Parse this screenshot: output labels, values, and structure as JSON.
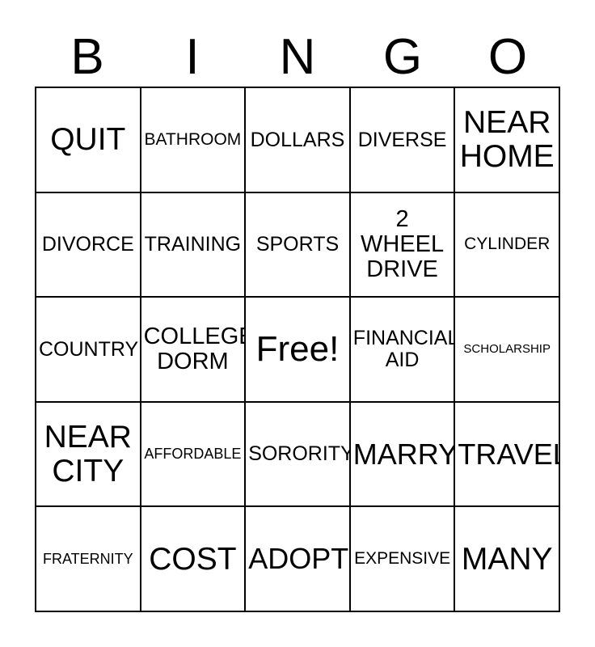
{
  "header": {
    "letters": [
      "B",
      "I",
      "N",
      "G",
      "O"
    ]
  },
  "grid": {
    "rows": 5,
    "columns": 5,
    "border_color": "#000000",
    "background_color": "#ffffff",
    "text_color": "#000000",
    "cells": [
      {
        "text": "QUIT",
        "size": "fs-xxl"
      },
      {
        "text": "BATHROOM",
        "size": "fs-s"
      },
      {
        "text": "DOLLARS",
        "size": "fs-m"
      },
      {
        "text": "DIVERSE",
        "size": "fs-m"
      },
      {
        "text": "NEAR\nHOME",
        "size": "fs-xxl"
      },
      {
        "text": "DIVORCE",
        "size": "fs-m"
      },
      {
        "text": "TRAINING",
        "size": "fs-m"
      },
      {
        "text": "SPORTS",
        "size": "fs-m"
      },
      {
        "text": "2\nWHEEL\nDRIVE",
        "size": "fs-l"
      },
      {
        "text": "CYLINDER",
        "size": "fs-s"
      },
      {
        "text": "COUNTRY",
        "size": "fs-m"
      },
      {
        "text": "COLLEGE\nDORM",
        "size": "fs-l"
      },
      {
        "text": "Free!",
        "size": "fs-free"
      },
      {
        "text": "FINANCIAL\nAID",
        "size": "fs-m"
      },
      {
        "text": "SCHOLARSHIP",
        "size": "fs-xxs"
      },
      {
        "text": "NEAR\nCITY",
        "size": "fs-xxl"
      },
      {
        "text": "AFFORDABLE",
        "size": "fs-xs"
      },
      {
        "text": "SORORITY",
        "size": "fs-m"
      },
      {
        "text": "MARRY",
        "size": "fs-xl"
      },
      {
        "text": "TRAVEL",
        "size": "fs-xl"
      },
      {
        "text": "FRATERNITY",
        "size": "fs-xs"
      },
      {
        "text": "COST",
        "size": "fs-xxl"
      },
      {
        "text": "ADOPT",
        "size": "fs-xl"
      },
      {
        "text": "EXPENSIVE",
        "size": "fs-s"
      },
      {
        "text": "MANY",
        "size": "fs-xxl"
      }
    ]
  }
}
